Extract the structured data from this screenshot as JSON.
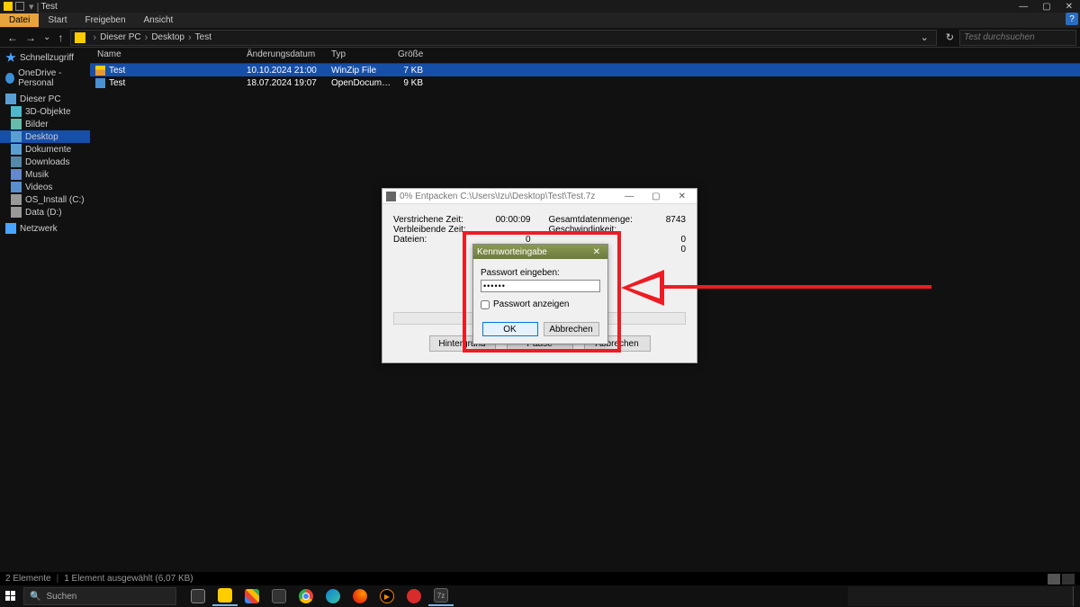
{
  "titlebar": {
    "title": "Test"
  },
  "titlebar_controls": {
    "min": "—",
    "max": "▢",
    "close": "✕"
  },
  "ribbon": {
    "file": "Datei",
    "start": "Start",
    "share": "Freigeben",
    "view": "Ansicht"
  },
  "breadcrumbs": {
    "pc": "Dieser PC",
    "desktop": "Desktop",
    "folder": "Test"
  },
  "search": {
    "placeholder": "Test durchsuchen"
  },
  "sidebar": {
    "quick": "Schnellzugriff",
    "onedrive": "OneDrive - Personal",
    "pc": "Dieser PC",
    "obj3d": "3D-Objekte",
    "pictures": "Bilder",
    "desktop": "Desktop",
    "documents": "Dokumente",
    "downloads": "Downloads",
    "music": "Musik",
    "videos": "Videos",
    "drive_c": "OS_Install (C:)",
    "drive_d": "Data (D:)",
    "network": "Netzwerk"
  },
  "columns": {
    "name": "Name",
    "date": "Änderungsdatum",
    "type": "Typ",
    "size": "Größe"
  },
  "files": [
    {
      "name": "Test",
      "date": "10.10.2024 21:00",
      "type": "WinZip File",
      "size": "7 KB",
      "icon": "fi-zip",
      "selected": true
    },
    {
      "name": "Test",
      "date": "18.07.2024 19:07",
      "type": "OpenDocument T...",
      "size": "9 KB",
      "icon": "fi-doc",
      "selected": false
    }
  ],
  "statusbar": {
    "count": "2 Elemente",
    "selected": "1 Element ausgewählt (6,07 KB)"
  },
  "extract": {
    "title": "0% Entpacken C:\\Users\\Izu\\Desktop\\Test\\Test.7z",
    "elapsed_l": "Verstrichene Zeit:",
    "elapsed_v": "00:00:09",
    "remaining_l": "Verbleibende Zeit:",
    "remaining_v": "",
    "files_l": "Dateien:",
    "files_v": "0",
    "total_l": "Gesamtdatenmenge:",
    "total_v": "8743",
    "speed_l": "Geschwindigkeit:",
    "speed_v": "",
    "compressed_l": "",
    "compressed_v": "0",
    "processed_l": "",
    "processed_v": "0",
    "btn_bg": "Hintergrund",
    "btn_pause": "Pause",
    "btn_cancel": "Abbrechen"
  },
  "password": {
    "title": "Kennworteingabe",
    "label": "Passwort eingeben:",
    "value": "••••••",
    "checkbox": "Passwort anzeigen",
    "ok": "OK",
    "cancel": "Abbrechen"
  },
  "taskbar": {
    "search": "Suchen"
  },
  "help": "?"
}
